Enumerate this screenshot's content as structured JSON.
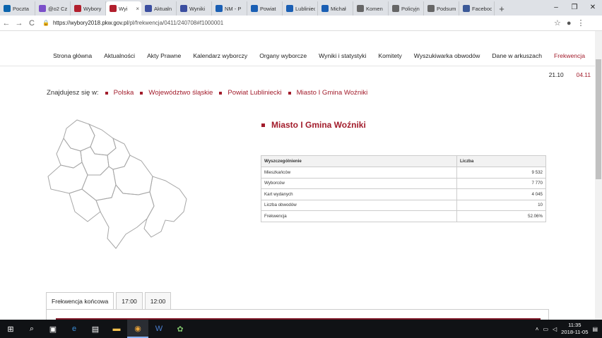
{
  "browser": {
    "tabs": [
      {
        "label": "Poczta",
        "color": "#0a64ad"
      },
      {
        "label": "@o2 Cz",
        "color": "#7b4fc9"
      },
      {
        "label": "Wybory",
        "color": "#b21f2d"
      },
      {
        "label": "Wyi",
        "color": "#b21f2d",
        "active": true
      },
      {
        "label": "Aktualn",
        "color": "#3b4ea0"
      },
      {
        "label": "Wyniki",
        "color": "#3b4ea0"
      },
      {
        "label": "NM - P",
        "color": "#1a5fb4"
      },
      {
        "label": "Powiat",
        "color": "#1a5fb4"
      },
      {
        "label": "Lubliniec",
        "color": "#1a5fb4"
      },
      {
        "label": "Michał",
        "color": "#1a5fb4"
      },
      {
        "label": "Komen",
        "color": "#666666"
      },
      {
        "label": "Policyjn",
        "color": "#666666"
      },
      {
        "label": "Podsum",
        "color": "#666666"
      },
      {
        "label": "Faceboo",
        "color": "#3b5998"
      }
    ],
    "new_tab_label": "+",
    "window_controls": {
      "minimize": "–",
      "maximize": "❐",
      "close": "✕"
    },
    "nav": {
      "back": "←",
      "forward": "→",
      "reload": "C"
    },
    "url_host": "https://wybory2018.pkw.gov.pl",
    "url_path": "/pl/frekwencja/0411/240708#f1000001",
    "star": "☆",
    "account": "●",
    "menu": "⋮"
  },
  "site": {
    "nav": [
      "Strona główna",
      "Aktualności",
      "Akty Prawne",
      "Kalendarz wyborczy",
      "Organy wyborcze",
      "Wyniki i statystyki",
      "Komitety",
      "Wyszukiwarka obwodów",
      "Dane w arkuszach",
      "Frekwencja"
    ],
    "nav_active_index": 9,
    "dates": [
      "21.10",
      "04.11"
    ],
    "breadcrumb": {
      "label": "Znajdujesz się w:",
      "items": [
        "Polska",
        "Województwo śląskie",
        "Powiat Lubliniecki",
        "Miasto I Gmina Woźniki"
      ]
    },
    "unit_title": "Miasto I Gmina Woźniki",
    "table": {
      "headers": [
        "Wyszczególnienie",
        "Liczba"
      ],
      "rows": [
        [
          "Mieszkańców",
          "9 532"
        ],
        [
          "Wyborców",
          "7 770"
        ],
        [
          "Kart wydanych",
          "4 045"
        ],
        [
          "Liczba obwodów",
          "10"
        ],
        [
          "Frekwencja",
          "52.06%"
        ]
      ]
    },
    "tabs": [
      "Frekwencja końcowa",
      "17:00",
      "12:00"
    ],
    "accent_color": "#a21c2b"
  },
  "taskbar": {
    "icons": [
      "windows-start-icon",
      "search-icon",
      "task-view-icon",
      "edge-icon",
      "store-icon",
      "file-explorer-icon",
      "chrome-icon",
      "word-icon",
      "paint-icon"
    ],
    "time": "11:35",
    "date": "2018-11-05"
  }
}
